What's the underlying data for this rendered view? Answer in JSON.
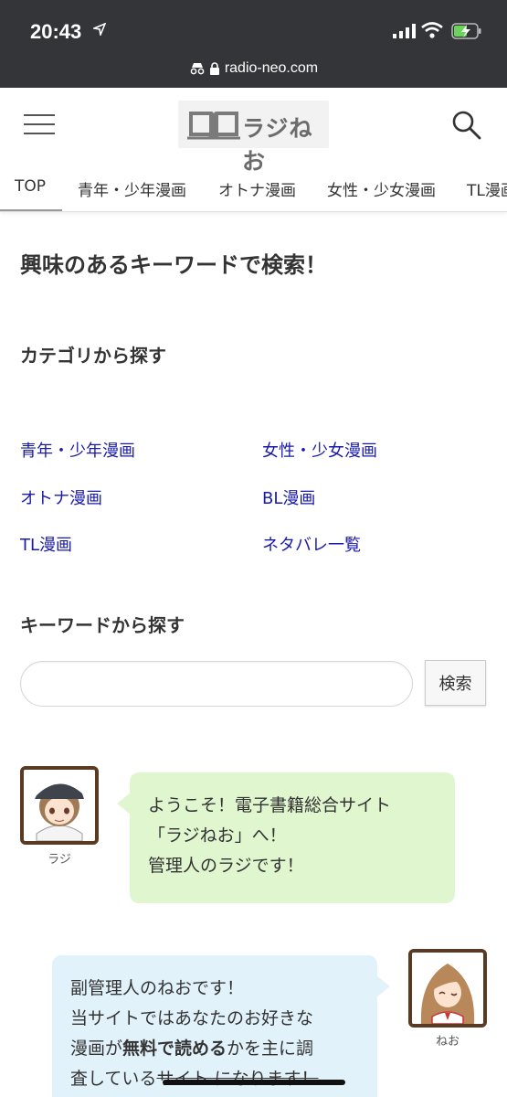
{
  "status_bar": {
    "time": "20:43",
    "url": "radio-neo.com"
  },
  "header": {
    "logo_text": "ラジねお"
  },
  "tabs": [
    "TOP",
    "青年・少年漫画",
    "オトナ漫画",
    "女性・少女漫画",
    "TL漫画"
  ],
  "main": {
    "title": "興味のあるキーワードで検索！",
    "category_heading": "カテゴリから探す",
    "categories": [
      "青年・少年漫画",
      "女性・少女漫画",
      "オトナ漫画",
      "BL漫画",
      "TL漫画",
      "ネタバレ一覧"
    ],
    "keyword_heading": "キーワードから探す",
    "search_placeholder": "",
    "search_button": "検索"
  },
  "chat": {
    "raji": {
      "name": "ラジ",
      "lines": [
        "ようこそ！電子書籍総合サイト",
        "「ラジねお」へ！",
        "管理人のラジです！"
      ]
    },
    "neo": {
      "name": "ねお",
      "line1": "副管理人のねおです！",
      "line2": "当サイトではあなたのお好きな",
      "line3_pre": "漫画が",
      "line3_bold": "無料で読める",
      "line3_post": "かを主に調",
      "line4_pre": "査している",
      "line4_strike": "サイト になります！"
    }
  },
  "colors": {
    "status_bg": "#333538",
    "link": "#1a1aa8",
    "bubble_green": "#dff6cf",
    "bubble_blue": "#e2f2fb",
    "avatar_border": "#5a3a22"
  }
}
